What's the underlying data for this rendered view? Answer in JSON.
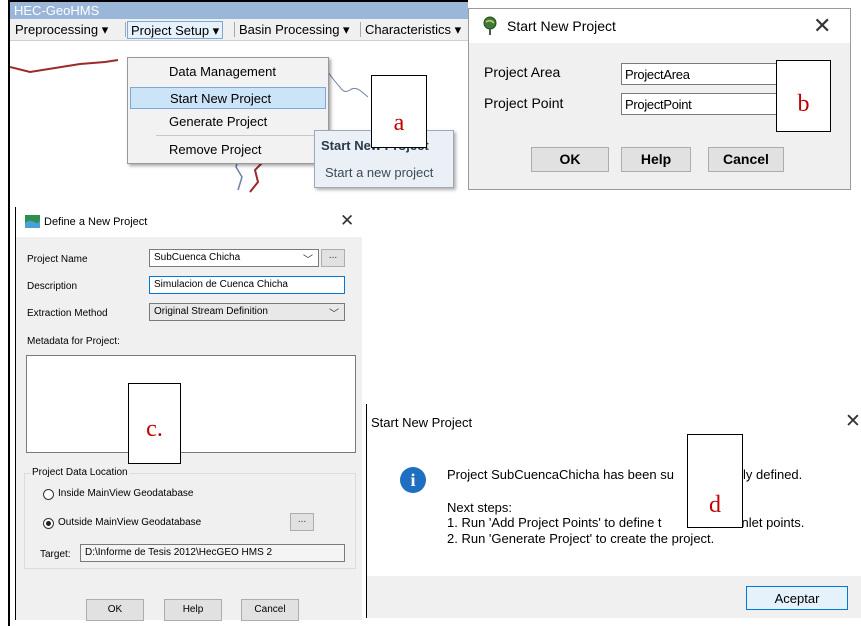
{
  "panel_a": {
    "app_title": "HEC-GeoHMS",
    "menubar": [
      "Preprocessing ▾",
      "Project Setup ▾",
      "Basin Processing ▾",
      "Characteristics ▾"
    ],
    "menu_items": [
      "Data Management",
      "Start New Project",
      "Generate Project",
      "Remove Project"
    ],
    "tooltip_title": "Start New Project",
    "tooltip_text": "Start a new project",
    "callout": "a"
  },
  "panel_b": {
    "title": "Start New Project",
    "close": "✕",
    "project_area_label": "Project Area",
    "project_area_value": "ProjectArea",
    "project_point_label": "Project Point",
    "project_point_value": "ProjectPoint",
    "ok_label": "OK",
    "help_label": "Help",
    "cancel_label": "Cancel",
    "callout": "b"
  },
  "panel_c": {
    "title": "Define a New Project",
    "close": "✕",
    "project_name_label": "Project Name",
    "project_name_value": "SubCuenca Chicha",
    "description_label": "Description",
    "description_value": "Simulacion de Cuenca Chicha",
    "extraction_label": "Extraction Method",
    "extraction_value": "Original Stream Definition",
    "metadata_label": "Metadata for Project:",
    "group_label": "Project Data Location",
    "radio_inside": "Inside MainView Geodatabase",
    "radio_outside": "Outside MainView Geodatabase",
    "target_label": "Target:",
    "target_value": "D:\\Informe de Tesis 2012\\HecGEO HMS 2",
    "browse_label": "...",
    "ok_label": "OK",
    "help_label": "Help",
    "cancel_label": "Cancel",
    "callout": "c."
  },
  "panel_d": {
    "title": "Start New Project",
    "close": "✕",
    "message": "Project SubCuencaChicha has been su",
    "message_end": "ly defined.",
    "next_steps": "Next steps:",
    "step1": "1. Run 'Add Project Points' to define t",
    "step1_end": "/inlet points.",
    "step2": "2. Run 'Generate Project' to create the project.",
    "ok_label": "Aceptar",
    "callout": "d"
  },
  "colors": {
    "title_bar": "#9ab6d8",
    "menu_hover": "#cce4f7",
    "info_icon": "#1e6fc0",
    "callout_text": "#c00000"
  }
}
